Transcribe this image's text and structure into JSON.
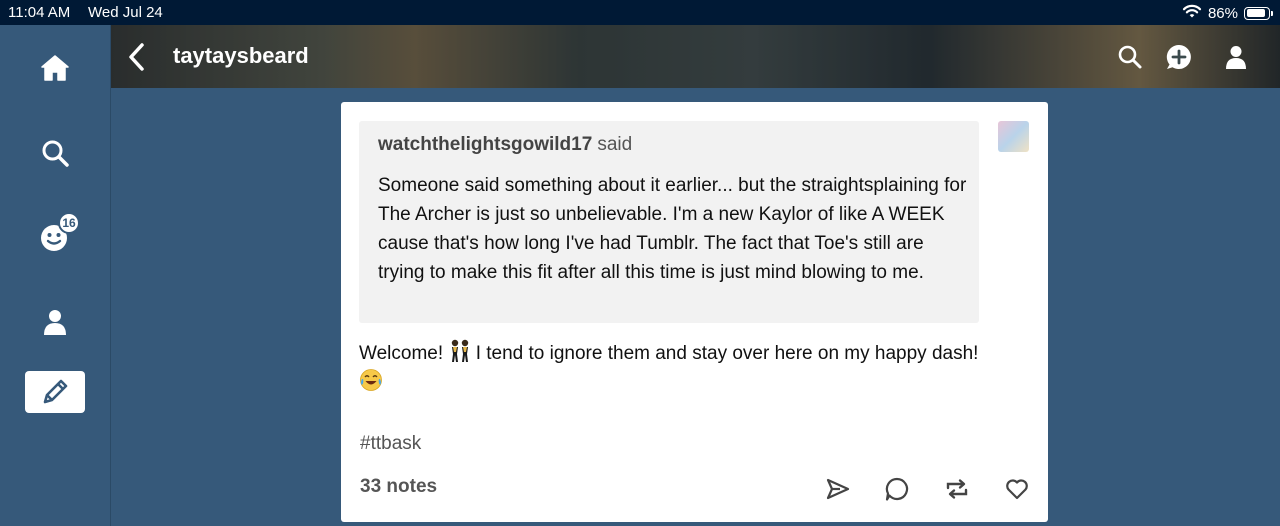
{
  "status_bar": {
    "time": "11:04 AM",
    "date": "Wed Jul 24",
    "battery_text": "86%",
    "battery_level": 0.86,
    "icons": [
      "wifi-icon",
      "battery-icon"
    ]
  },
  "sidebar": {
    "items": [
      {
        "name": "home",
        "icon": "home-icon"
      },
      {
        "name": "search",
        "icon": "search-icon"
      },
      {
        "name": "activity",
        "icon": "activity-face-icon",
        "badge": "16"
      },
      {
        "name": "account",
        "icon": "person-icon"
      },
      {
        "name": "compose",
        "icon": "pencil-icon",
        "active": true
      }
    ]
  },
  "header": {
    "blog_name": "taytaysbeard",
    "icons": [
      "back-chevron-icon",
      "search-icon",
      "plus-bubble-icon",
      "person-icon"
    ]
  },
  "post": {
    "quote": {
      "username": "watchthelightsgowild17",
      "said": "said",
      "text": "Someone said something about it earlier... but the straightsplaining for The Archer is just so unbelievable. I'm a new Kaylor of like A WEEK cause that's how long I've had Tumblr. The fact that Toe's still are trying to make this fit after all this time is just mind blowing to me."
    },
    "reply": {
      "part1": "Welcome!",
      "part2": "I tend to ignore them and stay over here on my happy dash!",
      "emoji1": "dancing-women-emoji",
      "emoji2": "tears-of-joy-emoji"
    },
    "tag": "#ttbask",
    "notes": "33 notes",
    "actions": [
      "share-icon",
      "reply-icon",
      "reblog-icon",
      "like-icon"
    ]
  },
  "colors": {
    "background": "#36597a",
    "status_bar": "#001935",
    "card": "#ffffff",
    "quote_bg": "#f2f2f2"
  }
}
